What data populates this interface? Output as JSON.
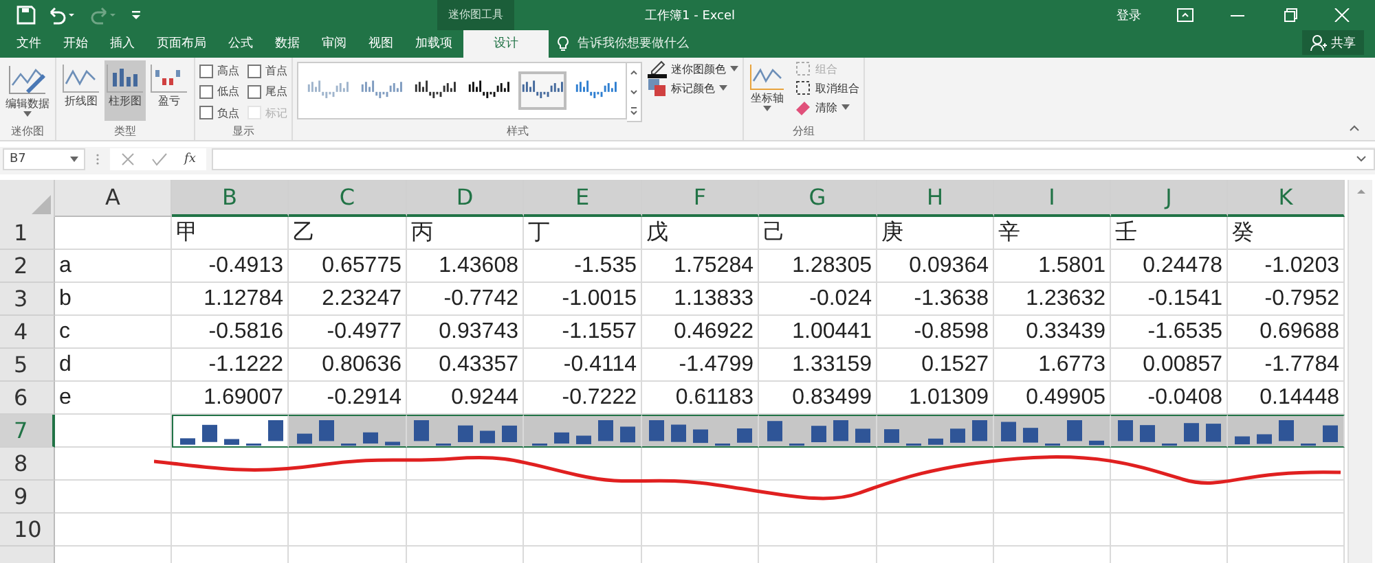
{
  "title_bar": {
    "contextual_label": "迷你图工具",
    "title": "工作簿1 - Excel",
    "sign_in": "登录"
  },
  "tabs": [
    {
      "label": "文件",
      "selected": false
    },
    {
      "label": "开始",
      "selected": false
    },
    {
      "label": "插入",
      "selected": false
    },
    {
      "label": "页面布局",
      "selected": false
    },
    {
      "label": "公式",
      "selected": false
    },
    {
      "label": "数据",
      "selected": false
    },
    {
      "label": "审阅",
      "selected": false
    },
    {
      "label": "视图",
      "selected": false
    },
    {
      "label": "加载项",
      "selected": false
    },
    {
      "label": "设计",
      "selected": true
    }
  ],
  "tell_me": {
    "placeholder": "告诉我你想要做什么"
  },
  "share_button": "共享",
  "ribbon": {
    "sparkline_group": {
      "label": "迷你图",
      "edit_data": "编辑数据"
    },
    "type_group": {
      "label": "类型",
      "types": [
        {
          "label": "折线图",
          "selected": false
        },
        {
          "label": "柱形图",
          "selected": true
        },
        {
          "label": "盈亏",
          "selected": false
        }
      ]
    },
    "show_group": {
      "label": "显示",
      "options": [
        {
          "label": "高点",
          "checked": false,
          "disabled": false
        },
        {
          "label": "首点",
          "checked": false,
          "disabled": false
        },
        {
          "label": "低点",
          "checked": false,
          "disabled": false
        },
        {
          "label": "尾点",
          "checked": false,
          "disabled": false
        },
        {
          "label": "负点",
          "checked": false,
          "disabled": false
        },
        {
          "label": "标记",
          "checked": false,
          "disabled": true
        }
      ]
    },
    "style_group": {
      "label": "样式",
      "styles": [
        {
          "selected": false,
          "color": "#9fb4cc"
        },
        {
          "selected": false,
          "color": "#7f9cc0"
        },
        {
          "selected": false,
          "color": "#333333"
        },
        {
          "selected": false,
          "color": "#111111"
        },
        {
          "selected": true,
          "color": "#44699c"
        },
        {
          "selected": false,
          "color": "#2f7fd1"
        }
      ],
      "sparkline_color": "迷你图颜色",
      "marker_color": "标记颜色"
    },
    "group_group": {
      "label": "分组",
      "axis": "坐标轴",
      "actions": [
        {
          "label": "组合",
          "disabled": true
        },
        {
          "label": "取消组合",
          "disabled": false
        },
        {
          "label": "清除",
          "disabled": false
        }
      ]
    }
  },
  "formula_bar": {
    "name_box": "B7",
    "function_label": "fx"
  },
  "sheet": {
    "columns": [
      {
        "label": "A",
        "selected": false
      },
      {
        "label": "B",
        "selected": true
      },
      {
        "label": "C",
        "selected": true
      },
      {
        "label": "D",
        "selected": true
      },
      {
        "label": "E",
        "selected": true
      },
      {
        "label": "F",
        "selected": true
      },
      {
        "label": "G",
        "selected": true
      },
      {
        "label": "H",
        "selected": true
      },
      {
        "label": "I",
        "selected": true
      },
      {
        "label": "J",
        "selected": true
      },
      {
        "label": "K",
        "selected": true
      }
    ],
    "rows": [
      {
        "label": "1",
        "kind": "header",
        "selected": false,
        "values": [
          "甲",
          "乙",
          "丙",
          "丁",
          "戊",
          "己",
          "庚",
          "辛",
          "壬",
          "癸"
        ]
      },
      {
        "label": "2",
        "kind": "data",
        "selected": false,
        "name": "a",
        "values": [
          "-0.4913",
          "0.65775",
          "1.43608",
          "-1.535",
          "1.75284",
          "1.28305",
          "0.09364",
          "1.5801",
          "0.24478",
          "-1.0203"
        ]
      },
      {
        "label": "3",
        "kind": "data",
        "selected": false,
        "name": "b",
        "values": [
          "1.12784",
          "2.23247",
          "-0.7742",
          "-1.0015",
          "1.13833",
          "-0.024",
          "-1.3638",
          "1.23632",
          "-0.1541",
          "-0.7952"
        ]
      },
      {
        "label": "4",
        "kind": "data",
        "selected": false,
        "name": "c",
        "values": [
          "-0.5816",
          "-0.4977",
          "0.93743",
          "-1.1557",
          "0.46922",
          "1.00441",
          "-0.8598",
          "0.33439",
          "-1.6535",
          "0.69688"
        ]
      },
      {
        "label": "5",
        "kind": "data",
        "selected": false,
        "name": "d",
        "values": [
          "-1.1222",
          "0.80636",
          "0.43357",
          "-0.4114",
          "-1.4799",
          "1.33159",
          "0.1527",
          "1.6773",
          "0.00857",
          "-1.7784"
        ]
      },
      {
        "label": "6",
        "kind": "data",
        "selected": false,
        "name": "e",
        "values": [
          "1.69007",
          "-0.2914",
          "0.9244",
          "-0.7222",
          "0.61183",
          "0.83499",
          "1.01309",
          "0.49905",
          "-0.0408",
          "0.14448"
        ]
      },
      {
        "label": "7",
        "kind": "sparkline",
        "selected": true
      },
      {
        "label": "8",
        "kind": "empty",
        "selected": false
      },
      {
        "label": "9",
        "kind": "empty",
        "selected": false
      },
      {
        "label": "10",
        "kind": "empty",
        "selected": false
      }
    ]
  }
}
